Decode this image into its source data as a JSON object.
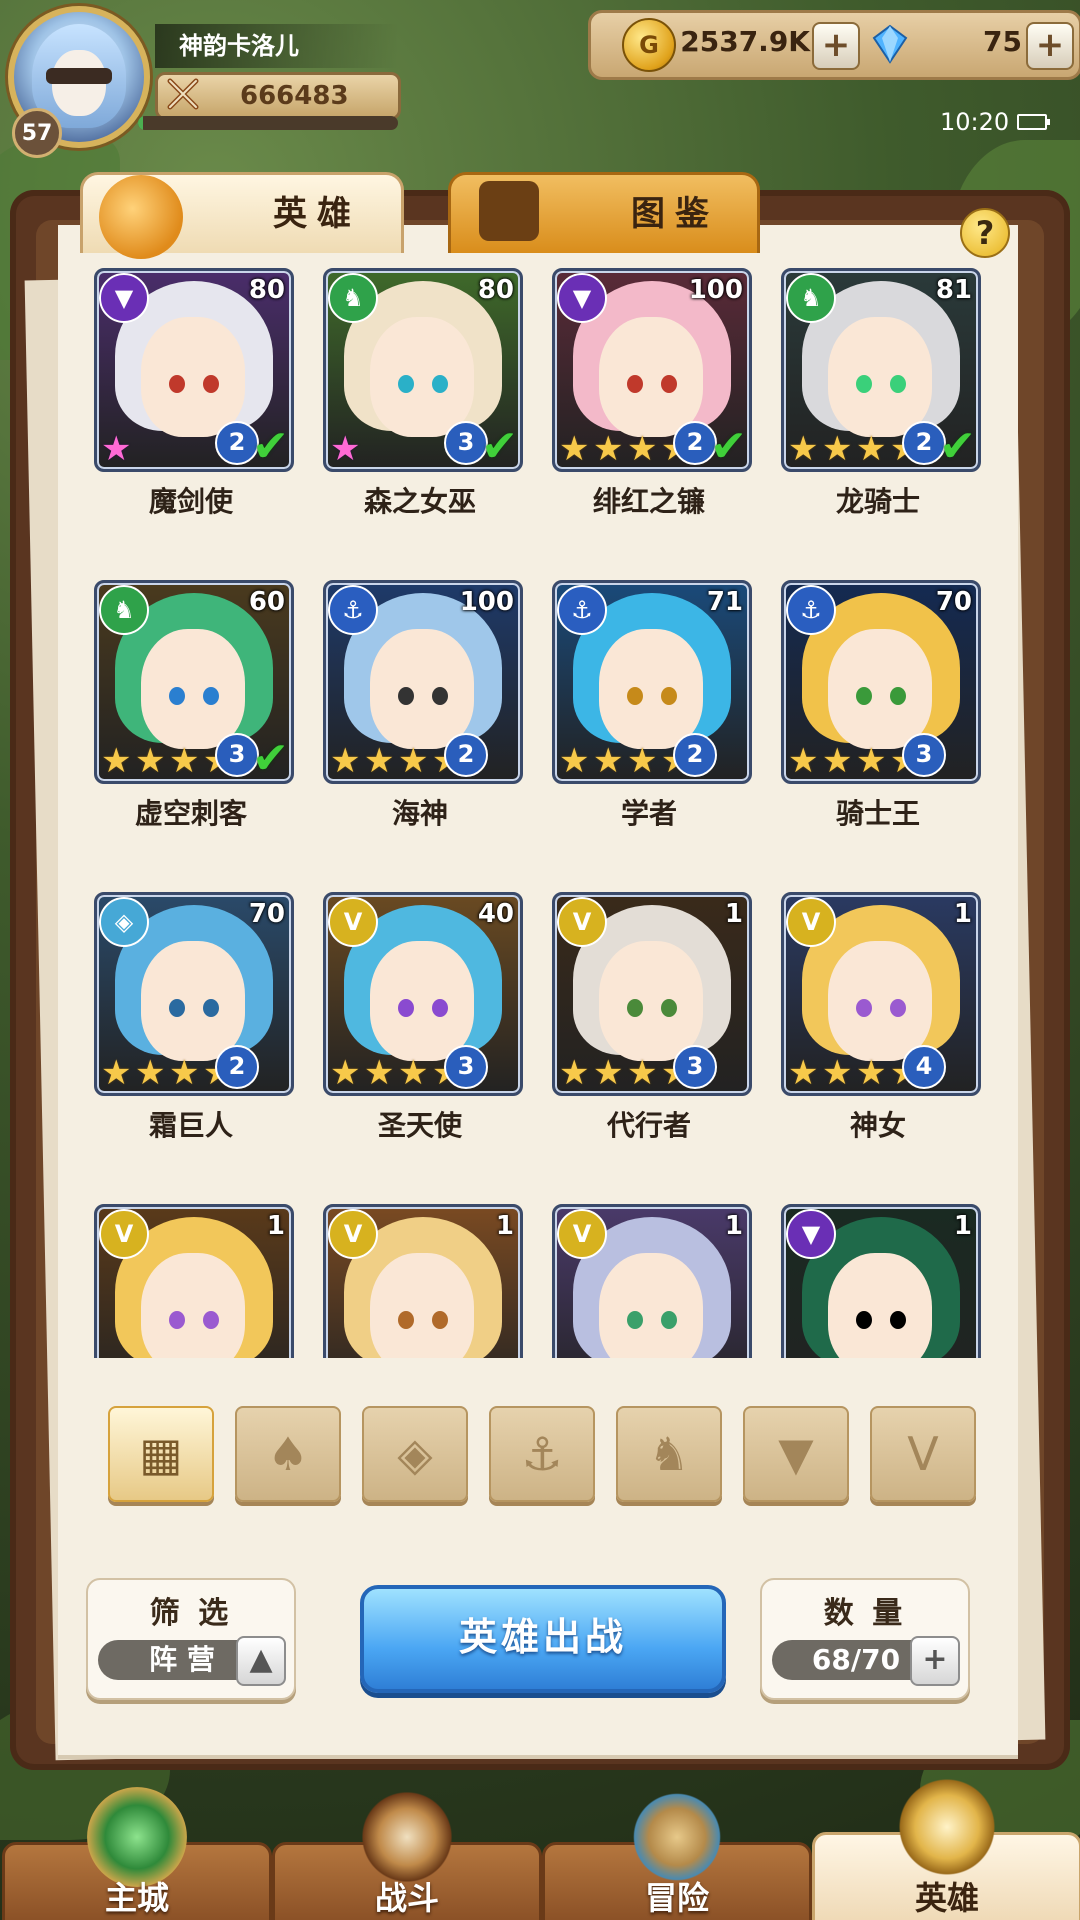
{
  "player": {
    "name": "神韵卡洛儿",
    "level": "57",
    "power": "666483",
    "xp_fraction": 0.02
  },
  "resources": {
    "gold": "2537.9K",
    "gems": "75",
    "plus_label": "+"
  },
  "status": {
    "time": "10:20"
  },
  "tabs": [
    {
      "label": "英雄",
      "icon": "knight-helmet-icon"
    },
    {
      "label": "图鉴",
      "icon": "magnifier-book-icon"
    }
  ],
  "help_label": "?",
  "heroes": [
    {
      "name": "魔剑使",
      "level": "80",
      "faction": "demon",
      "stars": 1,
      "rainbow": true,
      "evolve": "2",
      "check": true,
      "hair": "#e6e6ee",
      "bg": "#4a2d6b",
      "eye": "#c0392b"
    },
    {
      "name": "森之女巫",
      "level": "80",
      "faction": "beast",
      "stars": 1,
      "rainbow": true,
      "evolve": "3",
      "check": true,
      "hair": "#f0e2c8",
      "bg": "#3f6a2a",
      "eye": "#2ab0c8"
    },
    {
      "name": "绯红之镰",
      "level": "100",
      "faction": "demon",
      "stars": 4,
      "rainbow": false,
      "evolve": "2",
      "check": true,
      "hair": "#f3b9c9",
      "bg": "#5a2a38",
      "eye": "#c0392b"
    },
    {
      "name": "龙骑士",
      "level": "81",
      "faction": "beast",
      "stars": 4,
      "rainbow": false,
      "evolve": "2",
      "check": true,
      "hair": "#d9d9dc",
      "bg": "#2a3a3a",
      "eye": "#3ad07a"
    },
    {
      "name": "虚空刺客",
      "level": "60",
      "faction": "beast",
      "stars": 4,
      "rainbow": false,
      "evolve": "3",
      "check": true,
      "hair": "#3fb57a",
      "bg": "#4a3a1e",
      "eye": "#2a7fd0"
    },
    {
      "name": "海神",
      "level": "100",
      "faction": "ocean",
      "stars": 4,
      "rainbow": false,
      "evolve": "2",
      "check": false,
      "hair": "#9fc7ea",
      "bg": "#1e3a6a",
      "eye": "#333333"
    },
    {
      "name": "学者",
      "level": "71",
      "faction": "ocean",
      "stars": 4,
      "rainbow": false,
      "evolve": "2",
      "check": false,
      "hair": "#3cb6e6",
      "bg": "#1a4a7a",
      "eye": "#c68a1a"
    },
    {
      "name": "骑士王",
      "level": "70",
      "faction": "ocean",
      "stars": 4,
      "rainbow": false,
      "evolve": "3",
      "check": false,
      "hair": "#f1c24a",
      "bg": "#142a52",
      "eye": "#3a9a3a"
    },
    {
      "name": "霜巨人",
      "level": "70",
      "faction": "frost",
      "stars": 4,
      "rainbow": false,
      "evolve": "2",
      "check": false,
      "hair": "#5ab0e0",
      "bg": "#2a4a6a",
      "eye": "#2a6aa0"
    },
    {
      "name": "圣天使",
      "level": "40",
      "faction": "holy",
      "stars": 4,
      "rainbow": false,
      "evolve": "3",
      "check": false,
      "hair": "#4fb8e0",
      "bg": "#6a4a22",
      "eye": "#8a4ad0"
    },
    {
      "name": "代行者",
      "level": "1",
      "faction": "holy",
      "stars": 4,
      "rainbow": false,
      "evolve": "3",
      "check": false,
      "hair": "#e3ddd6",
      "bg": "#3a2a1a",
      "eye": "#4a8a3a"
    },
    {
      "name": "神女",
      "level": "1",
      "faction": "holy",
      "stars": 4,
      "rainbow": false,
      "evolve": "4",
      "check": false,
      "hair": "#f2c75a",
      "bg": "#2a3a62",
      "eye": "#9a5ad0"
    },
    {
      "name": "",
      "level": "1",
      "faction": "holy",
      "stars": 0,
      "rainbow": false,
      "evolve": "",
      "check": false,
      "hair": "#f2c75a",
      "bg": "#5a3a1a",
      "eye": "#9a5ad0"
    },
    {
      "name": "",
      "level": "1",
      "faction": "holy",
      "stars": 0,
      "rainbow": false,
      "evolve": "",
      "check": false,
      "hair": "#f0cf86",
      "bg": "#7a4a22",
      "eye": "#b06a2a"
    },
    {
      "name": "",
      "level": "1",
      "faction": "holy",
      "stars": 0,
      "rainbow": false,
      "evolve": "",
      "check": false,
      "hair": "#b9bfe0",
      "bg": "#4a3a6a",
      "eye": "#3aa06a"
    },
    {
      "name": "",
      "level": "1",
      "faction": "demon",
      "stars": 0,
      "rainbow": false,
      "evolve": "",
      "check": false,
      "hair": "#1f6a4a",
      "bg": "#1a2a22",
      "eye": "#000000"
    }
  ],
  "filters": [
    {
      "icon": "grid-icon",
      "glyph": "▦",
      "active": true
    },
    {
      "icon": "sprout-icon",
      "glyph": "♠",
      "active": false
    },
    {
      "icon": "frost-icon",
      "glyph": "◈",
      "active": false
    },
    {
      "icon": "anchor-icon",
      "glyph": "⚓",
      "active": false
    },
    {
      "icon": "beast-head-icon",
      "glyph": "♞",
      "active": false
    },
    {
      "icon": "demon-horns-icon",
      "glyph": "▼",
      "active": false
    },
    {
      "icon": "holy-wing-icon",
      "glyph": "V",
      "active": false
    }
  ],
  "controls": {
    "filter_title": "筛 选",
    "filter_value": "阵 营",
    "deploy_label": "英雄出战",
    "count_title": "数 量",
    "count_value": "68/70"
  },
  "nav": [
    {
      "label": "主城",
      "active": false,
      "icon": "castle-emblem-icon"
    },
    {
      "label": "战斗",
      "active": false,
      "icon": "crossed-swords-icon"
    },
    {
      "label": "冒险",
      "active": false,
      "icon": "scroll-map-icon"
    },
    {
      "label": "英雄",
      "active": true,
      "icon": "hero-crest-icon"
    }
  ],
  "colors": {
    "faction_demon": "#6a2fb5",
    "faction_beast": "#2fa24a",
    "faction_ocean": "#2a5ec0",
    "faction_frost": "#46a8d6",
    "faction_holy": "#d7b21f"
  }
}
